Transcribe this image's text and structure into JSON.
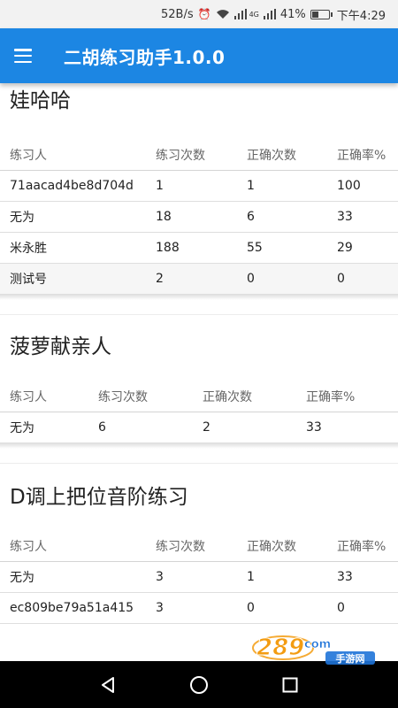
{
  "status_bar": {
    "net_speed": "52B/s",
    "net_type": "4G",
    "battery": "41%",
    "battery_level": 0.41,
    "time": "下午4:29"
  },
  "app_bar": {
    "title": "二胡练习助手1.0.0",
    "menu_icon": "hamburger-menu-icon"
  },
  "sections": [
    {
      "title": "娃哈哈",
      "headers": [
        "练习人",
        "练习次数",
        "正确次数",
        "正确率%"
      ],
      "rows": [
        [
          "71aacad4be8d704d",
          "1",
          "1",
          "100"
        ],
        [
          "无为",
          "18",
          "6",
          "33"
        ],
        [
          "米永胜",
          "188",
          "55",
          "29"
        ],
        [
          "测试号",
          "2",
          "0",
          "0"
        ]
      ]
    },
    {
      "title": "菠萝献亲人",
      "headers": [
        "练习人",
        "练习次数",
        "正确次数",
        "正确率%"
      ],
      "rows": [
        [
          "无为",
          "6",
          "2",
          "33"
        ]
      ]
    },
    {
      "title": "D调上把位音阶练习",
      "headers": [
        "练习人",
        "练习次数",
        "正确次数",
        "正确率%"
      ],
      "rows": [
        [
          "无为",
          "3",
          "1",
          "33"
        ],
        [
          "ec809be79a51a415",
          "3",
          "0",
          "0"
        ]
      ]
    }
  ],
  "watermark": {
    "number": "289",
    "suffix": "com",
    "subtitle": "手游网"
  },
  "nav_bar": {
    "back_icon": "back-triangle-icon",
    "home_icon": "home-circle-icon",
    "recents_icon": "recents-square-icon"
  },
  "colors": {
    "app_bar": "#1c86e3",
    "status_bar": "#f2f2f2",
    "nav_bar": "#000000",
    "watermark_orange": "#f39c12",
    "watermark_blue": "#1e73d8"
  }
}
